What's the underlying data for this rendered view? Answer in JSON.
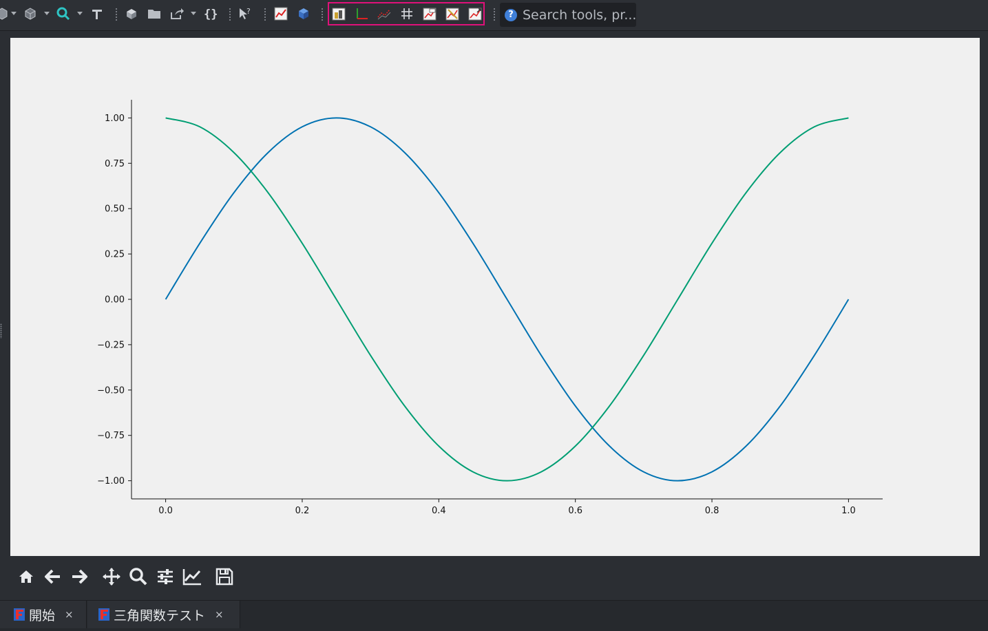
{
  "toolbar": {
    "search_placeholder": "Search tools, pr...",
    "help_glyph": "?",
    "icons": [
      "workbench-icon",
      "view-icon",
      "zoom-icon",
      "sketch-icon",
      "part-icon",
      "folder-icon",
      "export-icon",
      "macro-icon",
      "what-is-this-icon",
      "plot-icon",
      "fem-icon",
      "plot-series-icon",
      "plot-axes-icon",
      "plot-labels-icon",
      "plot-grid-icon",
      "plot-legend-icon",
      "plot-save-icon",
      "plot-positions-icon"
    ]
  },
  "nav_toolbar": {
    "icons": [
      "home-icon",
      "back-arrow-icon",
      "forward-arrow-icon",
      "pan-icon",
      "zoom-rect-icon",
      "subplots-config-icon",
      "edit-curves-icon",
      "save-figure-icon"
    ]
  },
  "tabs": [
    {
      "label": "開始",
      "close": "×",
      "icon": "freecad-icon"
    },
    {
      "label": "三角関数テスト",
      "close": "×",
      "icon": "freecad-icon"
    }
  ],
  "colors": {
    "series_sin": "#0072b2",
    "series_cos": "#009e73",
    "highlight_border": "#e0117a",
    "figure_bg": "#f0f0f0",
    "app_bg": "#2b2e33"
  },
  "chart_data": {
    "type": "line",
    "title": "",
    "xlabel": "",
    "ylabel": "",
    "xlim": [
      -0.05,
      1.05
    ],
    "ylim": [
      -1.1,
      1.1
    ],
    "x_ticks": [
      "0.0",
      "0.2",
      "0.4",
      "0.6",
      "0.8",
      "1.0"
    ],
    "x_tick_values": [
      0.0,
      0.2,
      0.4,
      0.6,
      0.8,
      1.0
    ],
    "y_ticks": [
      "1.00",
      "0.75",
      "0.50",
      "0.25",
      "0.00",
      "−0.25",
      "−0.50",
      "−0.75",
      "−1.00"
    ],
    "y_tick_values": [
      1.0,
      0.75,
      0.5,
      0.25,
      0.0,
      -0.25,
      -0.5,
      -0.75,
      -1.0
    ],
    "grid": false,
    "legend": false,
    "spines": "left-bottom",
    "series": [
      {
        "color": "#0072b2",
        "x": [
          0.0,
          0.05,
          0.1,
          0.15,
          0.2,
          0.25,
          0.3,
          0.35,
          0.4,
          0.45,
          0.5,
          0.55,
          0.6,
          0.65,
          0.7,
          0.75,
          0.8,
          0.85,
          0.9,
          0.95,
          1.0
        ],
        "y": [
          0.0,
          0.309,
          0.588,
          0.809,
          0.951,
          1.0,
          0.951,
          0.809,
          0.588,
          0.309,
          0.0,
          -0.309,
          -0.588,
          -0.809,
          -0.951,
          -1.0,
          -0.951,
          -0.809,
          -0.588,
          -0.309,
          0.0
        ]
      },
      {
        "color": "#009e73",
        "x": [
          0.0,
          0.05,
          0.1,
          0.15,
          0.2,
          0.25,
          0.3,
          0.35,
          0.4,
          0.45,
          0.5,
          0.55,
          0.6,
          0.65,
          0.7,
          0.75,
          0.8,
          0.85,
          0.9,
          0.95,
          1.0
        ],
        "y": [
          1.0,
          0.951,
          0.809,
          0.588,
          0.309,
          0.0,
          -0.309,
          -0.588,
          -0.809,
          -0.951,
          -1.0,
          -0.951,
          -0.809,
          -0.588,
          -0.309,
          0.0,
          0.309,
          0.588,
          0.809,
          0.951,
          1.0
        ]
      }
    ]
  }
}
